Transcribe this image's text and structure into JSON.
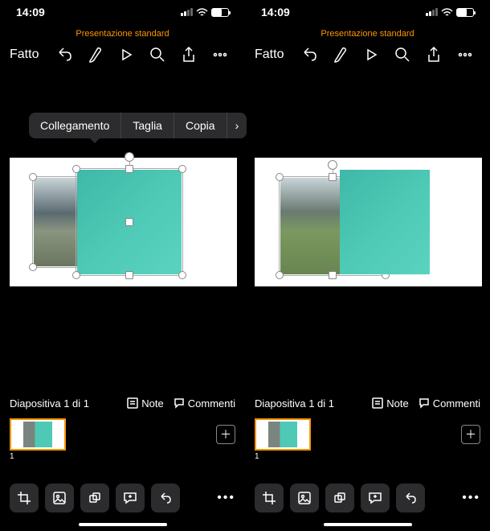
{
  "statusBar": {
    "time": "14:09"
  },
  "presetLabel": "Presentazione standard",
  "toolbar": {
    "done": "Fatto"
  },
  "contextMenu": {
    "items": [
      "Collegamento",
      "Taglia",
      "Copia"
    ],
    "more": "›"
  },
  "slideInfo": {
    "label": "Diapositiva 1 di 1",
    "notes": "Note",
    "comments": "Commenti"
  },
  "thumbStrip": {
    "slideNumber": "1",
    "addIcon": "＋"
  },
  "bottomMore": "•••"
}
